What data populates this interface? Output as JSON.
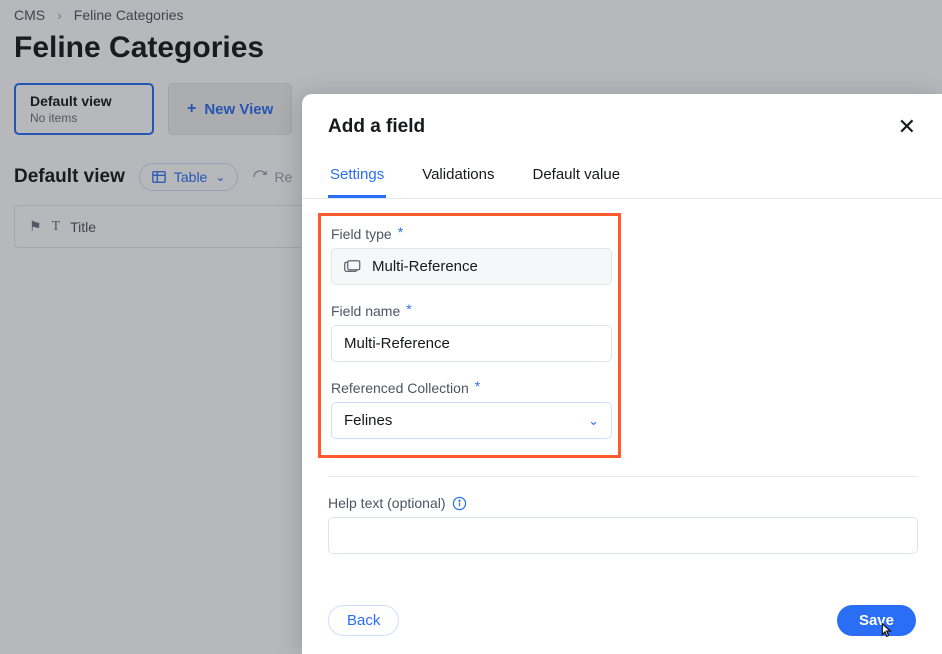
{
  "breadcrumb": {
    "root": "CMS",
    "current": "Feline Categories"
  },
  "page": {
    "title": "Feline Categories"
  },
  "views": {
    "default_name": "Default view",
    "default_sub": "No items",
    "new_view_label": "New View"
  },
  "viewbar": {
    "title": "Default view",
    "table_label": "Table",
    "refresh_label": "Re"
  },
  "grid": {
    "title_col": "Title"
  },
  "modal": {
    "title": "Add a field",
    "tabs": {
      "settings": "Settings",
      "validations": "Validations",
      "default": "Default value"
    },
    "field_type_label": "Field type",
    "field_type_value": "Multi-Reference",
    "field_name_label": "Field name",
    "field_name_value": "Multi-Reference",
    "ref_coll_label": "Referenced Collection",
    "ref_coll_value": "Felines",
    "help_label": "Help text (optional)",
    "help_value": "",
    "back": "Back",
    "save": "Save"
  }
}
